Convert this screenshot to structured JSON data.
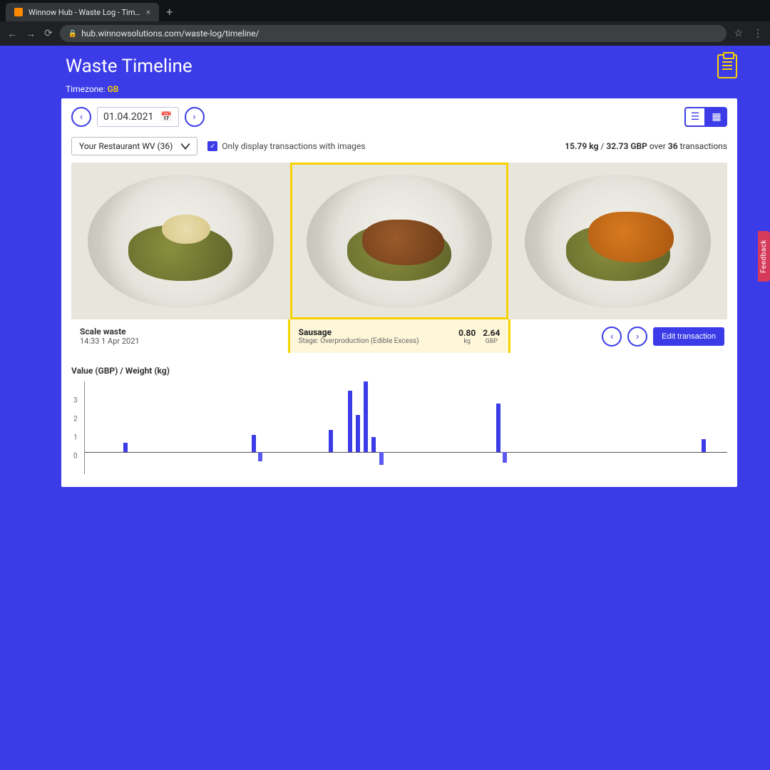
{
  "browser": {
    "tab_title": "Winnow Hub - Waste Log - Tim…",
    "url": "hub.winnowsolutions.com/waste-log/timeline/"
  },
  "header": {
    "title": "Waste Timeline",
    "timezone_label": "Timezone:",
    "timezone_value": "GB"
  },
  "controls": {
    "date": "01.04.2021",
    "restaurant_dropdown": "Your Restaurant WV (36)",
    "only_images_label": "Only display transactions with images",
    "only_images_checked": true,
    "summary_weight": "15.79 kg",
    "summary_value": "32.73 GBP",
    "summary_count": "36",
    "summary_suffix_1": "over",
    "summary_suffix_2": "transactions"
  },
  "detail": {
    "left_title": "Scale waste",
    "left_time": "14:33 1 Apr 2021",
    "item_name": "Sausage",
    "item_stage": "Stage: Overproduction (Edible Excess)",
    "weight_value": "0.80",
    "weight_unit": "kg",
    "cost_value": "2.64",
    "cost_unit": "GBP",
    "edit_label": "Edit transaction"
  },
  "chart_title": "Value (GBP) / Weight (kg)",
  "chart_data": {
    "type": "bar",
    "ylabel": "Value (GBP) / Weight (kg)",
    "ylim": [
      -1,
      4
    ],
    "y_ticks": [
      0,
      1,
      2,
      3
    ],
    "axis_y_fraction": 0.76,
    "bars": [
      {
        "x_pct": 6,
        "value": 0.5
      },
      {
        "x_pct": 26,
        "value": 0.9
      },
      {
        "x_pct": 27,
        "value": -0.5
      },
      {
        "x_pct": 38,
        "value": 1.2
      },
      {
        "x_pct": 41,
        "value": 3.3
      },
      {
        "x_pct": 42.2,
        "value": 2.0
      },
      {
        "x_pct": 43.4,
        "value": 3.8
      },
      {
        "x_pct": 44.6,
        "value": 0.8
      },
      {
        "x_pct": 45.8,
        "value": -0.7
      },
      {
        "x_pct": 64,
        "value": 2.6
      },
      {
        "x_pct": 65,
        "value": -0.6
      },
      {
        "x_pct": 96,
        "value": 0.7
      }
    ]
  },
  "feedback_label": "Feedback",
  "colors": {
    "primary": "#3b3be8",
    "accent": "#f7d100",
    "feedback": "#d63a5a"
  }
}
